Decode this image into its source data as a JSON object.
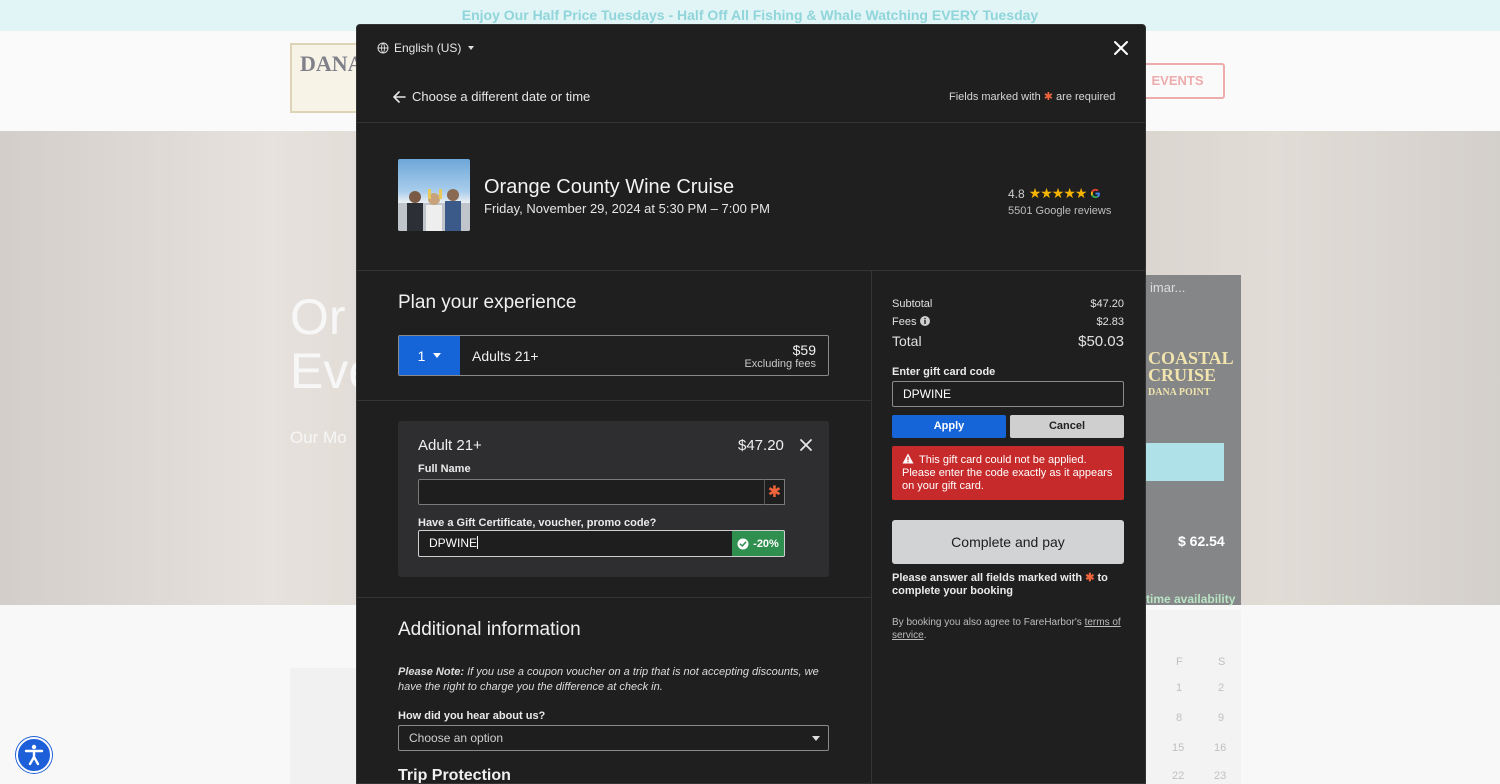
{
  "background": {
    "banner": "Enjoy Our Half Price Tuesdays - Half Off All Fishing & Whale Watching EVERY Tuesday",
    "logo_text": "DANA",
    "events_button": "EVENTS",
    "hero_title_line1": "Or",
    "hero_title_line2": "Eve",
    "hero_sub": "Our Mo",
    "card_text": "imar...",
    "coastal_lines": [
      "COASTAL",
      "CRUISE",
      "DANA POINT"
    ],
    "price": "$ 62.54",
    "availability": "time availability",
    "calendar_days": [
      "F",
      "S",
      "1",
      "2",
      "8",
      "9",
      "15",
      "16",
      "22",
      "23"
    ]
  },
  "modal": {
    "language": "English (US)",
    "back_label": "Choose a different date or time",
    "required_note_prefix": "Fields marked with",
    "required_note_suffix": "are required",
    "event": {
      "title": "Orange County Wine Cruise",
      "date": "Friday, November 29, 2024 at 5:30 PM – 7:00 PM",
      "rating": "4.8",
      "reviews": "5501 Google reviews"
    },
    "plan_heading": "Plan your experience",
    "ticket": {
      "quantity": "1",
      "label": "Adults 21+",
      "price": "$59",
      "fee_note": "Excluding fees"
    },
    "attendee": {
      "title": "Adult 21+",
      "price": "$47.20",
      "full_name_label": "Full Name",
      "full_name_value": "",
      "promo_label": "Have a Gift Certificate, voucher, promo code?",
      "promo_value": "DPWINE",
      "promo_badge": "-20%"
    },
    "additional_heading": "Additional information",
    "note_lead": "Please Note:",
    "note_body": "If you use a coupon voucher on a trip that is not accepting discounts, we have the right to charge you the difference at check in.",
    "hear_label": "How did you hear about us?",
    "hear_placeholder": "Choose an option",
    "trip_protection_heading": "Trip Protection",
    "summary": {
      "subtotal_label": "Subtotal",
      "subtotal_value": "$47.20",
      "fees_label": "Fees",
      "fees_value": "$2.83",
      "total_label": "Total",
      "total_value": "$50.03"
    },
    "gift": {
      "label": "Enter gift card code",
      "value": "DPWINE",
      "apply": "Apply",
      "cancel": "Cancel",
      "error": "This gift card could not be applied. Please enter the code exactly as it appears on your gift card."
    },
    "pay_button": "Complete and pay",
    "pay_note_prefix": "Please answer all fields marked with",
    "pay_note_suffix": "to complete your booking",
    "terms_prefix": "By booking you also agree to FareHarbor's",
    "terms_link": "terms of service",
    "terms_suffix": "."
  },
  "colors": {
    "accent_blue": "#1565d8",
    "error_red": "#c62a2a",
    "success_green": "#2f8f4e",
    "required_orange": "#f0643c",
    "star_gold": "#f4b400"
  },
  "icons": [
    "globe-icon",
    "caret-down-icon",
    "close-icon",
    "arrow-left-icon",
    "star-icon",
    "google-icon",
    "info-icon",
    "check-circle-icon",
    "warning-icon",
    "accessibility-icon"
  ]
}
